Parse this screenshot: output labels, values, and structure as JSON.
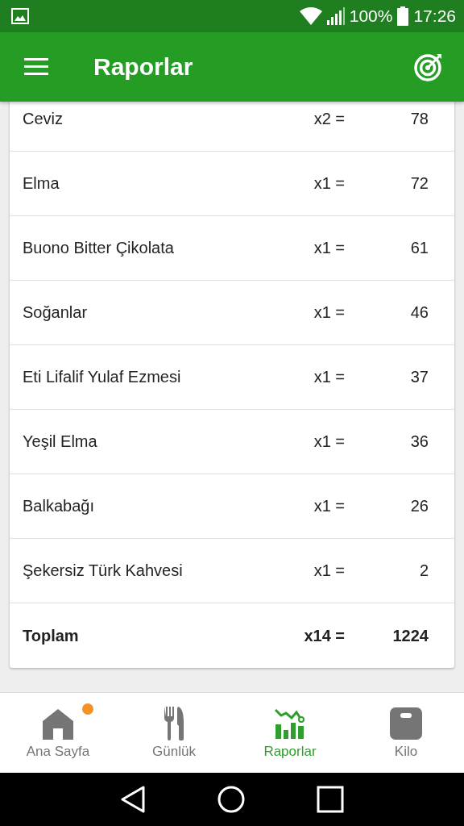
{
  "status_bar": {
    "battery": "100%",
    "time": "17:26"
  },
  "app_bar": {
    "title": "Raporlar"
  },
  "rows": [
    {
      "name": "Ceviz",
      "quantity": "x2 =",
      "value": "78"
    },
    {
      "name": "Elma",
      "quantity": "x1 =",
      "value": "72"
    },
    {
      "name": "Buono Bitter Çikolata",
      "quantity": "x1 =",
      "value": "61"
    },
    {
      "name": "Soğanlar",
      "quantity": "x1 =",
      "value": "46"
    },
    {
      "name": "Eti Lifalif Yulaf Ezmesi",
      "quantity": "x1 =",
      "value": "37"
    },
    {
      "name": "Yeşil Elma",
      "quantity": "x1 =",
      "value": "36"
    },
    {
      "name": "Balkabağı",
      "quantity": "x1 =",
      "value": "26"
    },
    {
      "name": "Şekersiz Türk Kahvesi",
      "quantity": "x1 =",
      "value": "2"
    }
  ],
  "total": {
    "name": "Toplam",
    "quantity": "x14 =",
    "value": "1224"
  },
  "bottom_nav": [
    {
      "kind": "home",
      "label": "Ana Sayfa",
      "selected": false,
      "notification": true
    },
    {
      "kind": "diary",
      "label": "Günlük",
      "selected": false,
      "notification": false
    },
    {
      "kind": "reports",
      "label": "Raporlar",
      "selected": true,
      "notification": false
    },
    {
      "kind": "weight",
      "label": "Kilo",
      "selected": false,
      "notification": false
    }
  ]
}
